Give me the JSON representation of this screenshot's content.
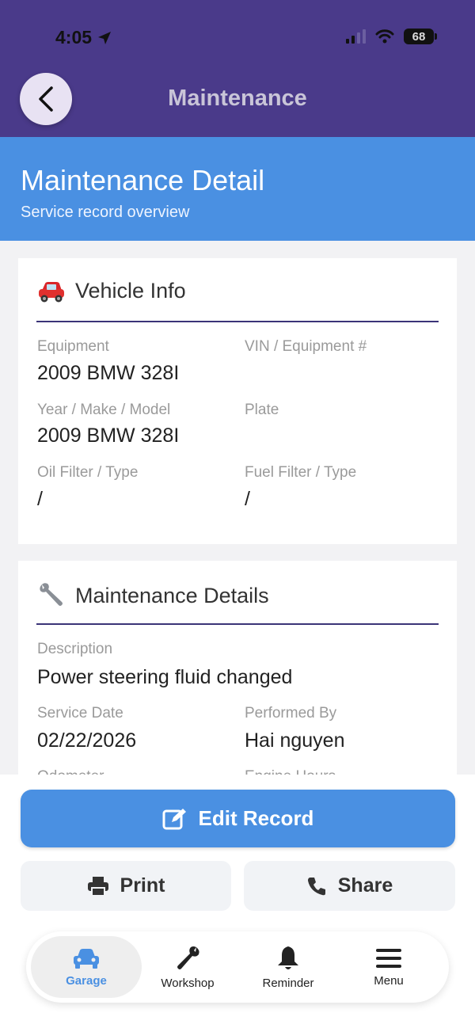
{
  "status": {
    "time": "4:05",
    "battery": "68"
  },
  "nav": {
    "title": "Maintenance"
  },
  "header": {
    "title": "Maintenance Detail",
    "subtitle": "Service record overview"
  },
  "vehicle": {
    "title": "Vehicle Info",
    "icon": "car-icon",
    "fields": [
      {
        "label": "Equipment",
        "value": "2009 BMW 328I"
      },
      {
        "label": "VIN / Equipment #",
        "value": ""
      },
      {
        "label": "Year / Make / Model",
        "value": "2009 BMW 328I"
      },
      {
        "label": "Plate",
        "value": ""
      },
      {
        "label": "Oil Filter / Type",
        "value": "/"
      },
      {
        "label": "Fuel Filter / Type",
        "value": "/"
      }
    ]
  },
  "maintenance": {
    "title": "Maintenance Details",
    "icon": "wrench-icon",
    "description_label": "Description",
    "description_value": "Power steering fluid changed",
    "service_date_label": "Service Date",
    "service_date_value": "02/22/2026",
    "performed_by_label": "Performed By",
    "performed_by_value": "Hai nguyen",
    "odometer_label": "Odometer",
    "engine_hours_label": "Engine Hours"
  },
  "actions": {
    "edit": "Edit Record",
    "print": "Print",
    "share": "Share"
  },
  "tabs": [
    {
      "label": "Garage",
      "icon": "car-icon",
      "active": true
    },
    {
      "label": "Workshop",
      "icon": "wrench-icon",
      "active": false
    },
    {
      "label": "Reminder",
      "icon": "bell-icon",
      "active": false
    },
    {
      "label": "Menu",
      "icon": "menu-icon",
      "active": false
    }
  ],
  "colors": {
    "purple": "#4a3a8a",
    "blue": "#4a90e2"
  }
}
